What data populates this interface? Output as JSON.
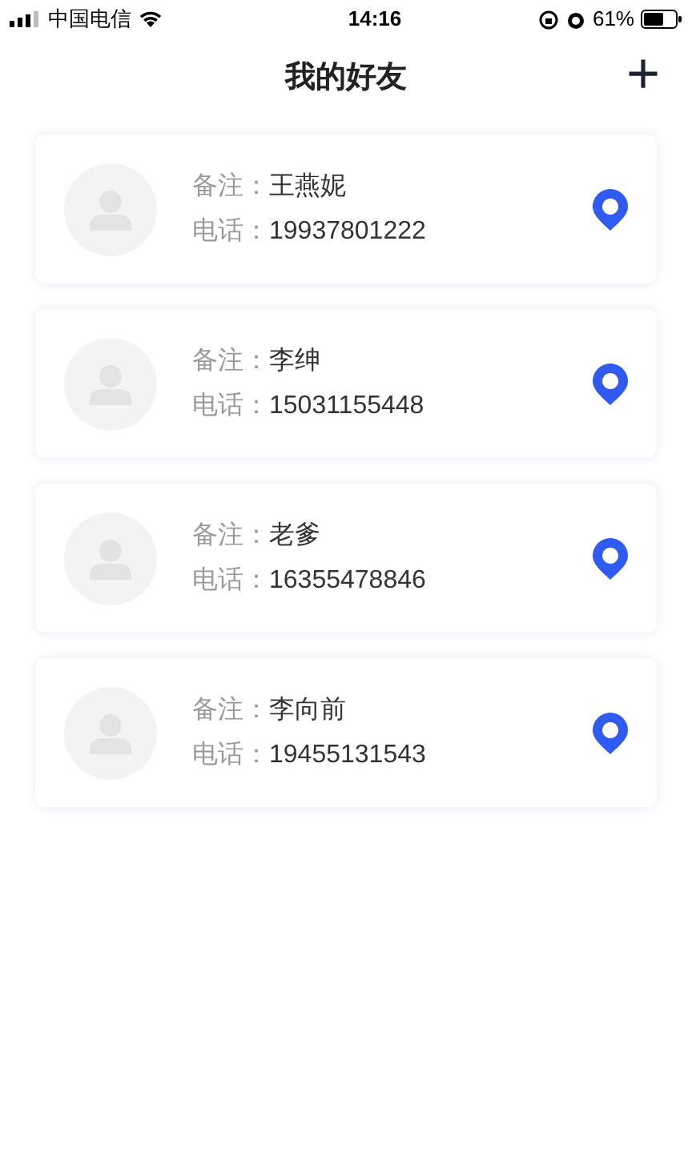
{
  "status_bar": {
    "carrier": "中国电信",
    "time": "14:16",
    "battery": "61%"
  },
  "header": {
    "title": "我的好友",
    "add_button": "+"
  },
  "friends": [
    {
      "note_label": "备注：",
      "note": "王燕妮",
      "phone_label": "电话：",
      "phone": "19937801222"
    },
    {
      "note_label": "备注：",
      "note": "李绅",
      "phone_label": "电话：",
      "phone": "15031155448"
    },
    {
      "note_label": "备注：",
      "note": "老爹",
      "phone_label": "电话：",
      "phone": "16355478846"
    },
    {
      "note_label": "备注：",
      "note": "李向前",
      "phone_label": "电话：",
      "phone": "19455131543"
    }
  ]
}
